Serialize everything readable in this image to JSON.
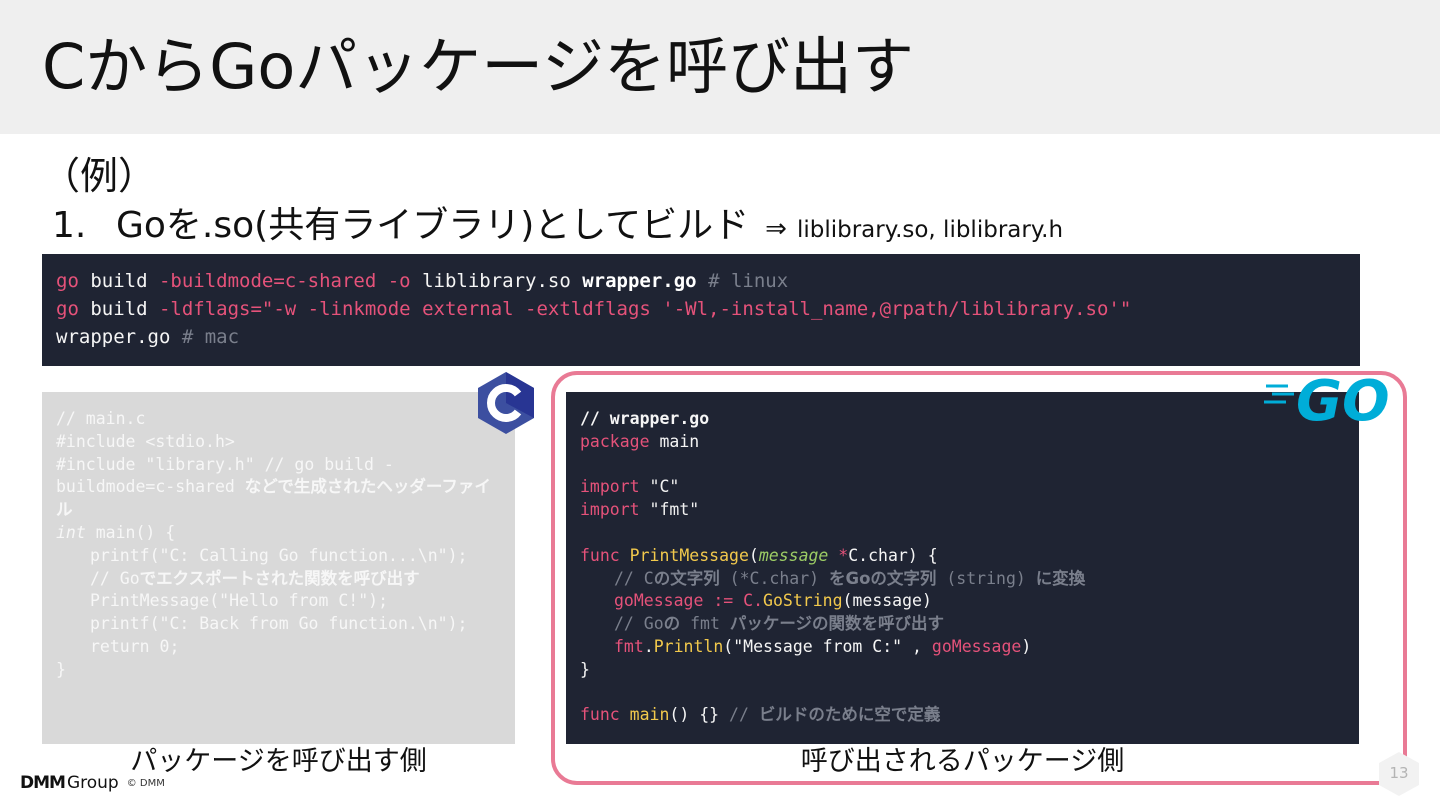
{
  "slide": {
    "title": "CからGoパッケージを呼び出す",
    "example_label": "（例）",
    "step_number": "1.",
    "step_text": "Goを.so(共有ライブラリ)としてビルド",
    "step_arrow": "⇒",
    "step_result": "liblibrary.so, liblibrary.h",
    "page_number": "13"
  },
  "command": {
    "line1": {
      "go": "go",
      "build": " build ",
      "flags": "-buildmode=c-shared -o",
      "out": " liblibrary.so ",
      "src": "wrapper.go",
      "comment": " # linux"
    },
    "line2": {
      "go": "go",
      "build": " build ",
      "flags": "-ldflags=\"-w -linkmode external -extldflags '-Wl,-install_name,@rpath/liblibrary.so'\""
    },
    "line3": {
      "src": "wrapper.go",
      "comment": " # mac"
    }
  },
  "c_code": {
    "l1": "// main.c",
    "l2": "#include <stdio.h>",
    "l3a": "#include \"library.h\" // go build -buildmode=c-shared ",
    "l3b": "などで生成されたヘッダーファイル",
    "l4a": "int",
    "l4b": " main() {",
    "l5": "printf(\"C: Calling Go function...\\n\");",
    "l6a": "// Go",
    "l6b": "でエクスポートされた関数を呼び出す",
    "l7": "PrintMessage(\"Hello from C!\");",
    "l8": "printf(\"C: Back from Go function.\\n\");",
    "l9": "return 0;",
    "l10": "}"
  },
  "go_code": {
    "l1": "// wrapper.go",
    "l2a": "package",
    "l2b": " main",
    "l3a": "import",
    "l3b": " \"C\"",
    "l4a": "import",
    "l4b": " \"fmt\"",
    "l5a": "func",
    "l5b": " PrintMessage",
    "l5c": "(",
    "l5d": "message",
    "l5e": " *",
    "l5f": "C.char) {",
    "l6a": "// C",
    "l6b": "の文字列",
    "l6c": " (*C.char) ",
    "l6d": "をGoの文字列",
    "l6e": " (string) ",
    "l6f": "に変換",
    "l7a": "goMessage",
    "l7b": " := ",
    "l7c": "C.",
    "l7d": "GoString",
    "l7e": "(message)",
    "l8a": "// Go",
    "l8b": "の",
    "l8c": " fmt ",
    "l8d": "パッケージの関数を呼び出す",
    "l9a": "fmt",
    "l9b": ".",
    "l9c": "Println",
    "l9d": "(\"Message from C:\" , ",
    "l9e": "goMessage",
    "l9f": ")",
    "l10": "}",
    "l11a": "func",
    "l11b": " main",
    "l11c": "() {} ",
    "l11d": "// ",
    "l11e": "ビルドのために空で定義"
  },
  "captions": {
    "left": "パッケージを呼び出す側",
    "right": "呼び出されるパッケージ側"
  },
  "logos": {
    "c_icon": "c-language-icon",
    "go_icon": "go-language-icon",
    "go_text": "GO"
  },
  "brand": {
    "dmm": "DMM",
    "group": "Group",
    "copyright": "© DMM"
  },
  "colors": {
    "code_bg": "#1f2433",
    "c_code_bg": "#d9d9d9",
    "keyword_pink": "#e5527a",
    "function_yellow": "#f2c94c",
    "param_green": "#9ccc65",
    "frame_pink": "#e97a95",
    "go_blue": "#00add8",
    "c_blue": "#3c4fa0"
  }
}
